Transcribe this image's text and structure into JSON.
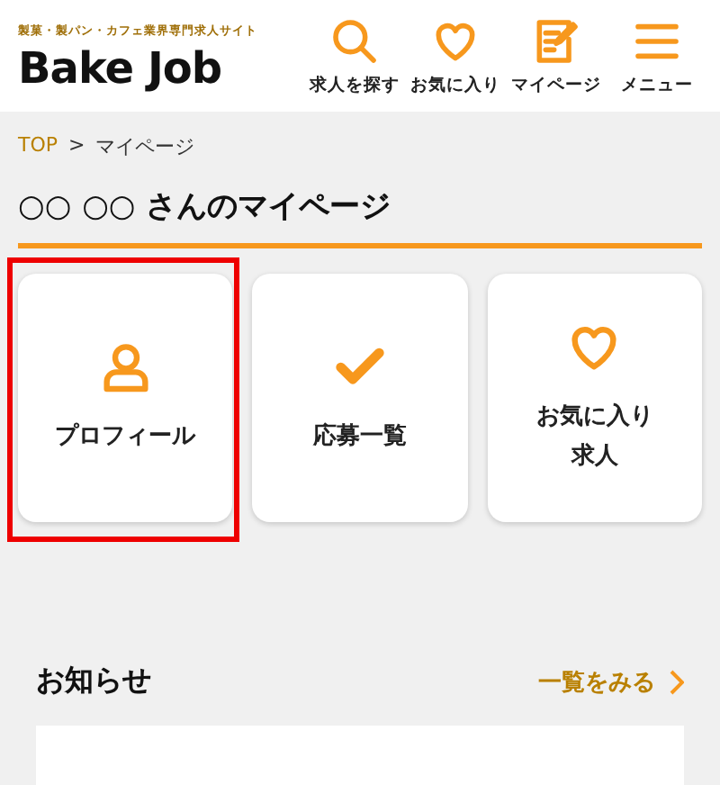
{
  "header": {
    "tagline": "製菓・製パン・カフェ業界専門求人サイト",
    "logo": "Bake Job",
    "nav": [
      {
        "kind": "search",
        "label": "求人を探す"
      },
      {
        "kind": "heart",
        "label": "お気に入り"
      },
      {
        "kind": "note",
        "label": "マイページ"
      },
      {
        "kind": "menu",
        "label": "メニュー"
      }
    ]
  },
  "breadcrumb": [
    {
      "label": "TOP",
      "link": true
    },
    {
      "label": "マイページ",
      "link": false
    }
  ],
  "breadcrumb_separator": ">",
  "title": "○○ ○○ さんのマイページ",
  "cards": [
    {
      "kind": "person",
      "label_lines": [
        "プロフィール"
      ],
      "highlighted": true
    },
    {
      "kind": "check",
      "label_lines": [
        "応募一覧"
      ],
      "highlighted": false
    },
    {
      "kind": "heart",
      "label_lines": [
        "お気に入り",
        "求人"
      ],
      "highlighted": false
    }
  ],
  "news": {
    "title": "お知らせ",
    "more": "一覧をみる"
  }
}
